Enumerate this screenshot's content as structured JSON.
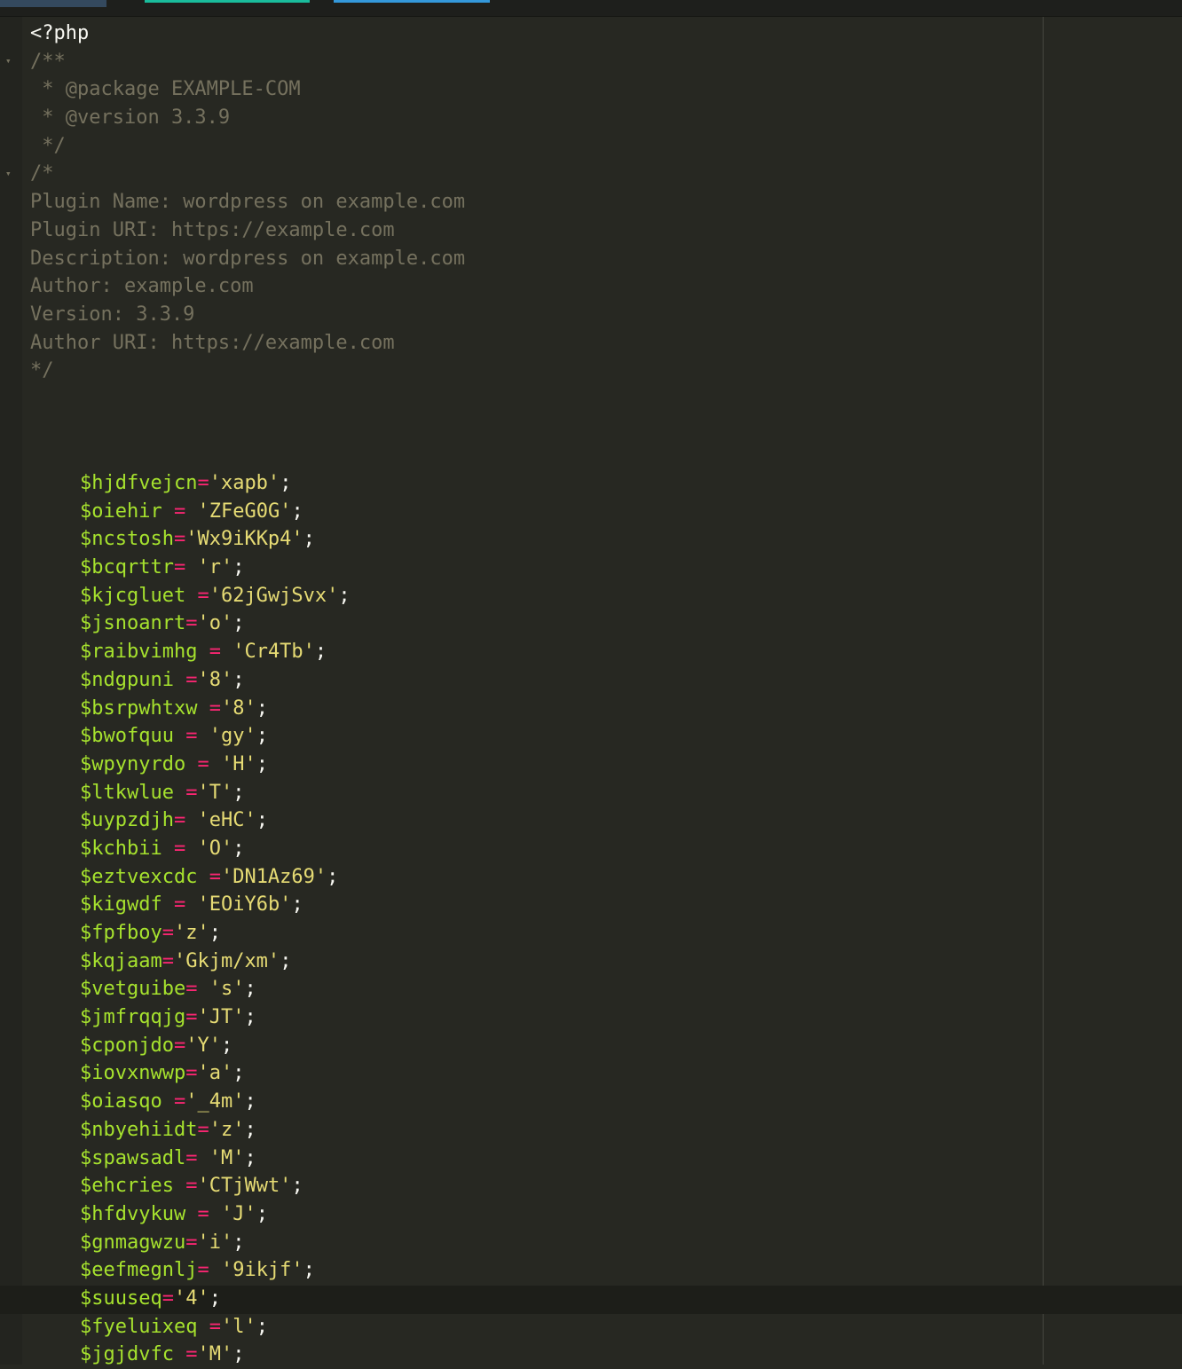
{
  "theme": {
    "background": "#272822",
    "comment": "#75715e",
    "variable": "#a6e22e",
    "operator": "#f92672",
    "string": "#e6db74",
    "text": "#f8f8f2"
  },
  "editor": {
    "open_tag": "<?php",
    "doc_comment": [
      "/**",
      " * @package EXAMPLE-COM",
      " * @version 3.3.9",
      " */"
    ],
    "header_comment": [
      "/*",
      "Plugin Name: wordpress on example.com",
      "Plugin URI: https://example.com",
      "Description: wordpress on example.com",
      "Author: example.com",
      "Version: 3.3.9",
      "Author URI: https://example.com",
      "*/"
    ],
    "assignments": [
      {
        "var": "$hjdfvejcn",
        "op": "=",
        "val": "'xapb'"
      },
      {
        "var": "$oiehir ",
        "op": "= ",
        "val": "'ZFeG0G'"
      },
      {
        "var": "$ncstosh",
        "op": "=",
        "val": "'Wx9iKKp4'"
      },
      {
        "var": "$bcqrttr",
        "op": "= ",
        "val": "'r'"
      },
      {
        "var": "$kjcgluet ",
        "op": "=",
        "val": "'62jGwjSvx'"
      },
      {
        "var": "$jsnoanrt",
        "op": "=",
        "val": "'o'"
      },
      {
        "var": "$raibvimhg ",
        "op": "= ",
        "val": "'Cr4Tb'"
      },
      {
        "var": "$ndgpuni ",
        "op": "=",
        "val": "'8'"
      },
      {
        "var": "$bsrpwhtxw ",
        "op": "=",
        "val": "'8'"
      },
      {
        "var": "$bwofquu ",
        "op": "= ",
        "val": "'gy'"
      },
      {
        "var": "$wpynyrdo ",
        "op": "= ",
        "val": "'H'"
      },
      {
        "var": "$ltkwlue ",
        "op": "=",
        "val": "'T'"
      },
      {
        "var": "$uypzdjh",
        "op": "= ",
        "val": "'eHC'"
      },
      {
        "var": "$kchbii ",
        "op": "= ",
        "val": "'O'"
      },
      {
        "var": "$eztvexcdc ",
        "op": "=",
        "val": "'DN1Az69'"
      },
      {
        "var": "$kigwdf ",
        "op": "= ",
        "val": "'EOiY6b'"
      },
      {
        "var": "$fpfboy",
        "op": "=",
        "val": "'z'"
      },
      {
        "var": "$kqjaam",
        "op": "=",
        "val": "'Gkjm/xm'"
      },
      {
        "var": "$vetguibe",
        "op": "= ",
        "val": "'s'"
      },
      {
        "var": "$jmfrqqjg",
        "op": "=",
        "val": "'JT'"
      },
      {
        "var": "$cponjdo",
        "op": "=",
        "val": "'Y'"
      },
      {
        "var": "$iovxnwwp",
        "op": "=",
        "val": "'a'"
      },
      {
        "var": "$oiasqo ",
        "op": "=",
        "val": "'_4m'"
      },
      {
        "var": "$nbyehiidt",
        "op": "=",
        "val": "'z'"
      },
      {
        "var": "$spawsadl",
        "op": "= ",
        "val": "'M'"
      },
      {
        "var": "$ehcries ",
        "op": "=",
        "val": "'CTjWwt'"
      },
      {
        "var": "$hfdvykuw ",
        "op": "= ",
        "val": "'J'"
      },
      {
        "var": "$gnmagwzu",
        "op": "=",
        "val": "'i'"
      },
      {
        "var": "$eefmegnlj",
        "op": "= ",
        "val": "'9ikjf'"
      },
      {
        "var": "$suuseq",
        "op": "=",
        "val": "'4'"
      },
      {
        "var": "$fyeluixeq ",
        "op": "=",
        "val": "'l'"
      },
      {
        "var": "$jgjdvfc ",
        "op": "=",
        "val": "'M'"
      }
    ]
  }
}
